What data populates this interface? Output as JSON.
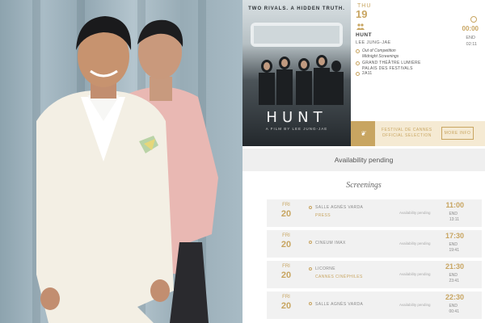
{
  "poster": {
    "tagline": "TWO RIVALS. A HIDDEN TRUTH.",
    "title": "HUNT",
    "credit": "A FILM BY LEE JUNG-JAE"
  },
  "event": {
    "day": "THU",
    "date": "19",
    "title": "HUNT",
    "director": "LEE JUNG-JAE",
    "section_line1": "Out of Competition",
    "section_line2": "Midnight Screenings",
    "venue_line1": "GRAND THÉÂTRE LUMIÈRE",
    "venue_line2": "PALAIS DES FESTIVALS",
    "code": "2A11",
    "start_time": "00:00",
    "end_label": "END",
    "end_time": "02:11"
  },
  "festival": {
    "line1": "FESTIVAL DE CANNES",
    "line2": "OFFICIAL SELECTION",
    "more_info": "MORE INFO"
  },
  "availability": "Availability pending",
  "screenings_title": "Screenings",
  "screenings": [
    {
      "day": "FRI",
      "date": "20",
      "venue": "SALLE AGNÈS VARDA",
      "sub": "PRESS",
      "availability": "Availability pending",
      "start": "11:00",
      "end_label": "END",
      "end": "13:11"
    },
    {
      "day": "FRI",
      "date": "20",
      "venue": "CINEUM IMAX",
      "sub": "",
      "availability": "Availability pending",
      "start": "17:30",
      "end_label": "END",
      "end": "19:41"
    },
    {
      "day": "FRI",
      "date": "20",
      "venue": "LICORNE",
      "sub": "CANNES CINÉPHILES",
      "availability": "Availability pending",
      "start": "21:30",
      "end_label": "END",
      "end": "23:41"
    },
    {
      "day": "FRI",
      "date": "20",
      "venue": "SALLE AGNÈS VARDA",
      "sub": "",
      "availability": "Availability pending",
      "start": "22:30",
      "end_label": "END",
      "end": "00:41"
    }
  ],
  "colors": {
    "gold": "#c8a561",
    "panel_grey": "#f1f1f1",
    "festival_bg": "#f5ead3"
  }
}
